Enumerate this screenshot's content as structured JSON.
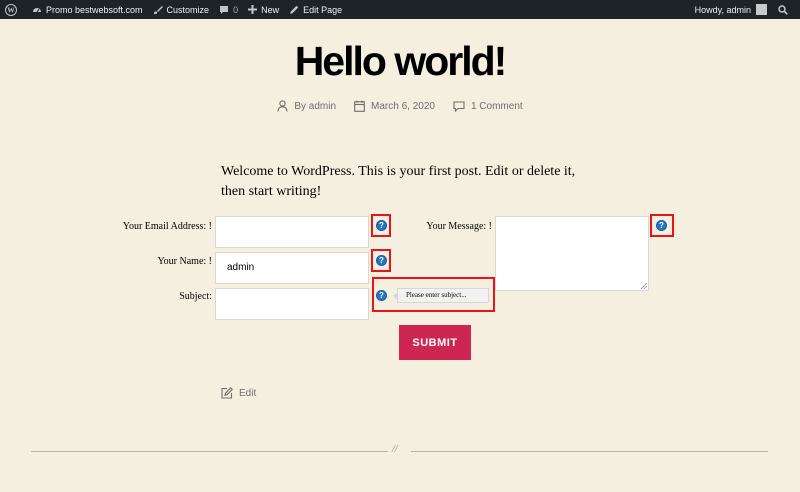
{
  "adminbar": {
    "wp_logo_icon": "wordpress-icon",
    "site_name": "Promo bestwebsoft.com",
    "customize": "Customize",
    "comments_count": "0",
    "new": "New",
    "edit_page": "Edit Page",
    "howdy": "Howdy, admin"
  },
  "post": {
    "title": "Hello world!",
    "author": "By admin",
    "date": "March 6, 2020",
    "comments": "1 Comment",
    "intro": "Welcome to WordPress. This is your first post. Edit or delete it, then start writing!"
  },
  "form": {
    "email_label": "Your Email Address: !",
    "email_value": "",
    "name_label": "Your Name: !",
    "name_value": "admin",
    "subject_label": "Subject:",
    "subject_value": "",
    "message_label": "Your Message: !",
    "message_value": "",
    "help_glyph": "?",
    "subject_tooltip": "Please enter subject...",
    "submit_label": "SUBMIT"
  },
  "footer": {
    "edit_label": "Edit",
    "separator_mark": "//"
  },
  "colors": {
    "background": "#f5efe0",
    "adminbar": "#1d2327",
    "accent": "#cd2653",
    "highlight_box": "#e8141b",
    "help_icon": "#2575c6"
  }
}
